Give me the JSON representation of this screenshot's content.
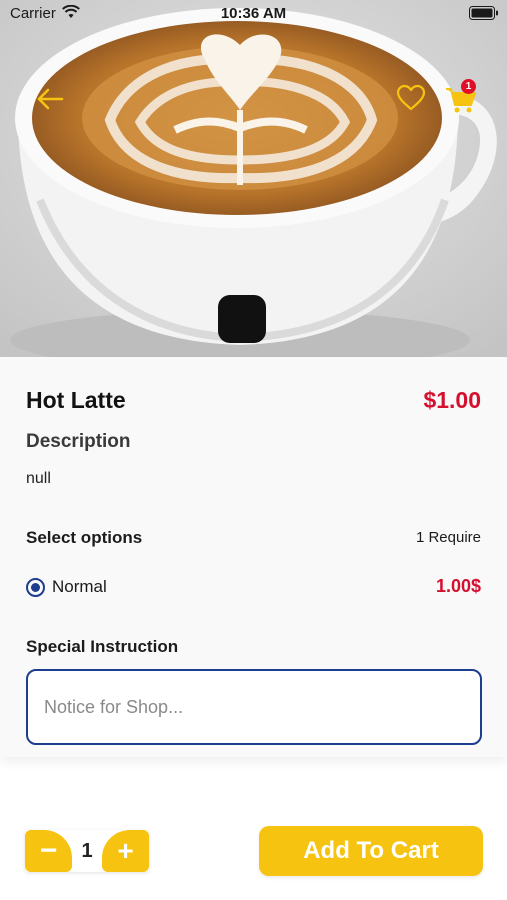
{
  "status_bar": {
    "carrier": "Carrier",
    "time": "10:36 AM"
  },
  "header": {
    "back_icon": "arrow-left-icon",
    "favorite_icon": "heart-outline-icon",
    "cart_icon": "shopping-cart-icon",
    "cart_badge_count": "1"
  },
  "product": {
    "name": "Hot Latte",
    "price": "$1.00",
    "description_heading": "Description",
    "description": "null"
  },
  "options": {
    "heading": "Select options",
    "requirement": "1 Require",
    "items": [
      {
        "label": "Normal",
        "price": "1.00$",
        "selected": true
      }
    ]
  },
  "special_instruction": {
    "heading": "Special Instruction",
    "placeholder": "Notice for Shop...",
    "value": ""
  },
  "quantity": {
    "value": "1",
    "minus_label": "−",
    "plus_label": "+"
  },
  "add_to_cart_label": "Add To Cart",
  "colors": {
    "accent": "#f6c311",
    "price_red": "#d5102f",
    "selection_blue": "#1d3d8f"
  }
}
